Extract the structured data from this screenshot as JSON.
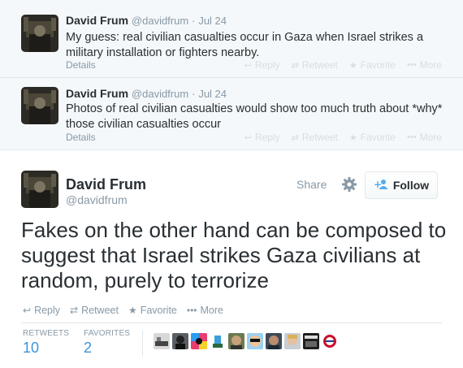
{
  "colors": {
    "link": "#3b94d9",
    "muted": "#8899a6",
    "text": "#292f33",
    "reply_bg": "#f5f8fa"
  },
  "replies": [
    {
      "name": "David Frum",
      "handle": "@davidfrum",
      "separator": "·",
      "date": "Jul 24",
      "text": "My guess: real civilian casualties occur in Gaza when Israel strikes a military installation or fighters nearby.",
      "details": "Details",
      "actions": {
        "reply": "Reply",
        "retweet": "Retweet",
        "favorite": "Favorite",
        "more": "More"
      }
    },
    {
      "name": "David Frum",
      "handle": "@davidfrum",
      "separator": "·",
      "date": "Jul 24",
      "text": "Photos of real civilian casualties would show too much truth about *why* those civilian casualties occur",
      "details": "Details",
      "actions": {
        "reply": "Reply",
        "retweet": "Retweet",
        "favorite": "Favorite",
        "more": "More"
      }
    }
  ],
  "main": {
    "name": "David Frum",
    "handle": "@davidfrum",
    "share": "Share",
    "follow": "Follow",
    "text": "Fakes on the other hand can be composed to suggest that Israel strikes Gaza civilians at random, purely to terrorize",
    "actions": {
      "reply": "Reply",
      "retweet": "Retweet",
      "favorite": "Favorite",
      "more": "More"
    },
    "stats": {
      "retweets_label": "RETWEETS",
      "retweets": "10",
      "favorites_label": "FAVORITES",
      "favorites": "2"
    }
  },
  "icons": {
    "reply": "reply-icon",
    "retweet": "retweet-icon",
    "favorite": "star-icon",
    "more": "ellipsis-icon",
    "gear": "gear-icon",
    "follow": "add-person-icon"
  }
}
